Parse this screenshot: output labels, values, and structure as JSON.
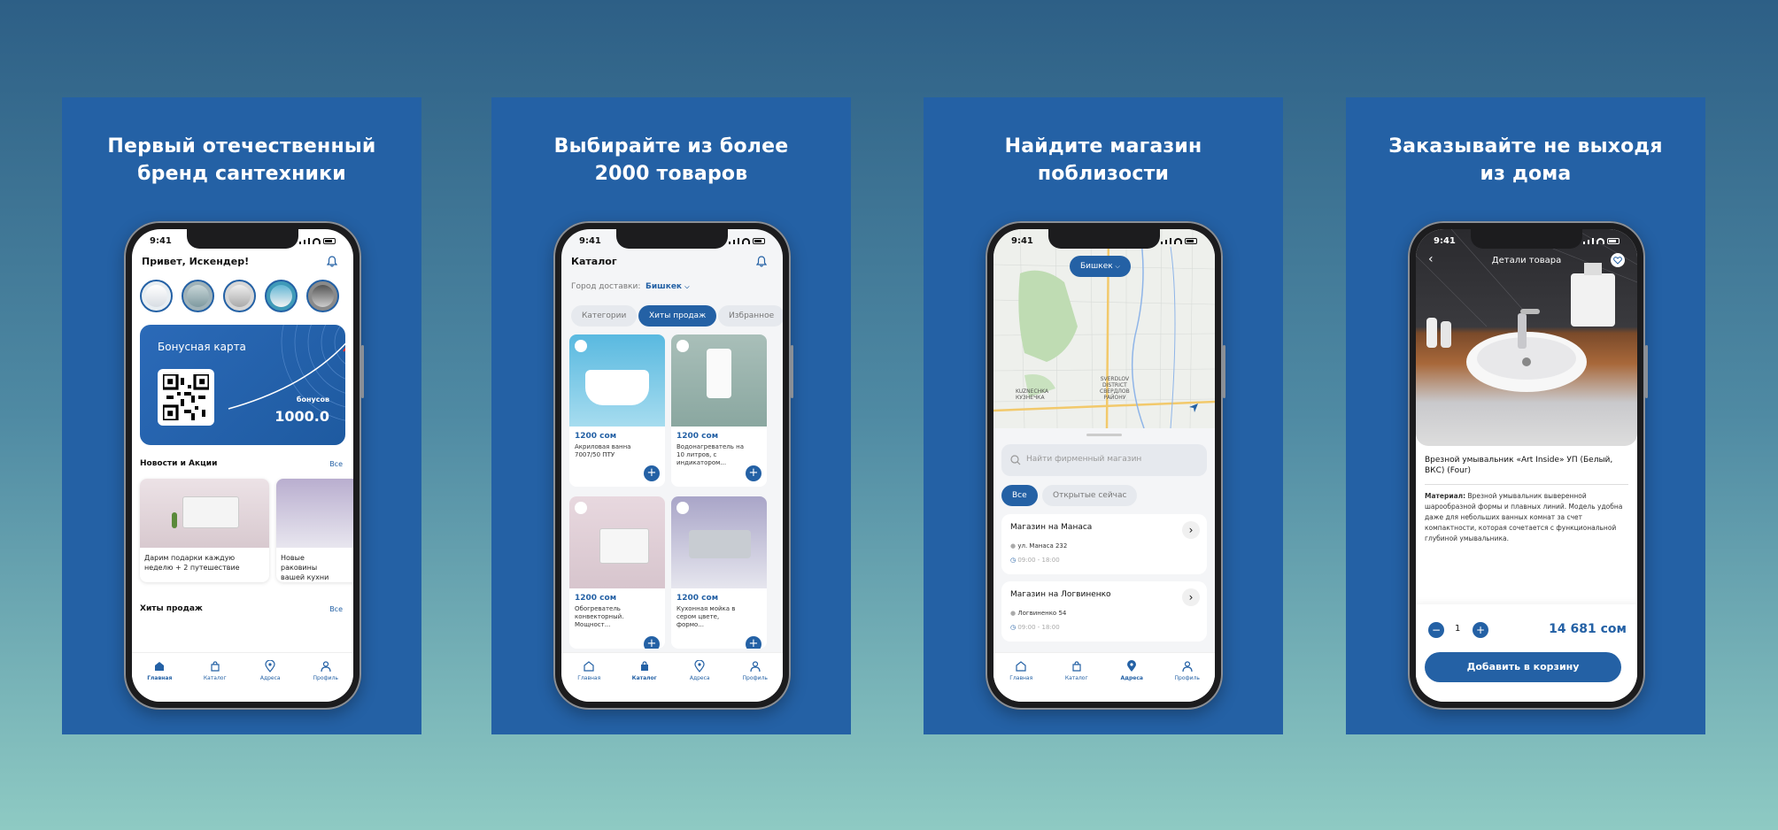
{
  "panels": [
    {
      "title_line1": "Первый отечественный",
      "title_line2": "бренд сантехники"
    },
    {
      "title_line1": "Выбирайте из более",
      "title_line2": "2000 товаров"
    },
    {
      "title_line1": "Найдите магазин",
      "title_line2": "поблизости"
    },
    {
      "title_line1": "Заказывайте не выходя",
      "title_line2": "из дома"
    }
  ],
  "status_time": "9:41",
  "tabs": [
    "Главная",
    "Каталог",
    "Адреса",
    "Профиль"
  ],
  "home": {
    "greeting": "Привет, Искендер!",
    "bonus_card_title": "Бонусная карта",
    "bonus_label": "бонусов",
    "bonus_value": "1000.0",
    "news_title": "Новости и Акции",
    "all_link": "Все",
    "news": [
      {
        "text": "Дарим подарки каждую неделю + 2 путешествие"
      },
      {
        "text": "Новые раковины вашей кухни"
      }
    ],
    "hits_title": "Хиты продаж",
    "hits_all": "Все"
  },
  "catalog": {
    "title": "Каталог",
    "delivery_label": "Город доставки:",
    "delivery_city": "Бишкек",
    "chips": [
      "Категории",
      "Хиты продаж",
      "Избранное"
    ],
    "products": [
      {
        "price": "1200 сом",
        "name": "Акриловая ванна 7007/50 ПТУ"
      },
      {
        "price": "1200 сом",
        "name": "Водонагреватель на 10 литров, с индикатором..."
      },
      {
        "price": "1200 сом",
        "name": "Обогреватель конвекторный. Мощност..."
      },
      {
        "price": "1200 сом",
        "name": "Кухонная мойка в сером цвете, формо..."
      }
    ]
  },
  "map": {
    "city_pill": "Бишкек",
    "district_label_1": "SVERDLOV",
    "district_label_2": "DISTRICT",
    "district_label_3": "СВЕРДЛОВ",
    "district_label_4": "РАЙОНУ",
    "area_label_1": "KUZNECHKA",
    "area_label_2": "КУЗНЕЧКА",
    "search_placeholder": "Найти фирменный магазин",
    "filters": [
      "Все",
      "Открытые сейчас"
    ],
    "stores": [
      {
        "name": "Магазин на Манаса",
        "address": "ул. Манаса 232",
        "hours": "09:00 - 18:00"
      },
      {
        "name": "Магазин на Логвиненко",
        "address": "Логвиненко 54",
        "hours": "09:00 - 18:00"
      }
    ]
  },
  "detail": {
    "title": "Детали товара",
    "product_name": "Врезной умывальник «Art Inside» УП (Белый, ВКС) (Four)",
    "material_label": "Материал:",
    "description": "Врезной умывальник выверенной шарообразной формы и плавных линий. Модель удобна даже для небольших ванных комнат за счет компактности, которая сочетается с функциональной глубиной умывальника.",
    "quantity": "1",
    "price": "14 681 сом",
    "add_to_cart": "Добавить в корзину"
  },
  "colors": {
    "brand": "#2461a5",
    "background_top": "#2d5f86",
    "background_bottom": "#8ecac3"
  }
}
